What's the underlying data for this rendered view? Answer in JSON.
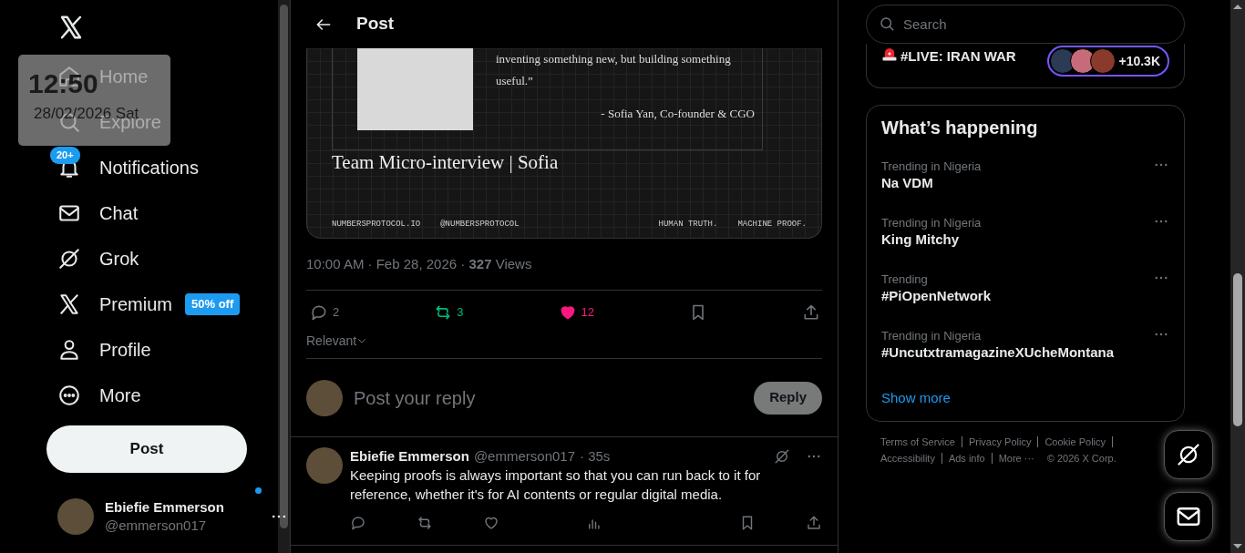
{
  "clock": {
    "time": "12:50",
    "date": "28/02/2026 Sat"
  },
  "sidebar": {
    "items": [
      {
        "label": "Home",
        "selected": false
      },
      {
        "label": "Explore",
        "selected": false
      },
      {
        "label": "Notifications",
        "selected": false,
        "badge": "20+"
      },
      {
        "label": "Chat",
        "selected": false
      },
      {
        "label": "Grok",
        "selected": false
      },
      {
        "label": "Premium",
        "selected": false,
        "tag": "50% off"
      },
      {
        "label": "Profile",
        "selected": false
      },
      {
        "label": "More",
        "selected": false
      }
    ],
    "post_button": "Post",
    "account": {
      "name": "Ebiefie Emmerson",
      "handle": "@emmerson017",
      "unread": true
    }
  },
  "post": {
    "title": "Post",
    "media": {
      "quote": "inventing something new, but building something useful.”",
      "attribution": "- Sofia Yan, Co-founder & CGO",
      "caption": "Team Micro-interview | Sofia",
      "footer_left": [
        "NUMBERSPROTOCOL.IO",
        "@NUMBERSPROTOCOL"
      ],
      "footer_right": [
        "HUMAN TRUTH.",
        "MACHINE PROOF."
      ]
    },
    "meta": "10:00 AM · Feb 28, 2026 · **327** Views",
    "actions": [
      {
        "kind": "reply",
        "count": "2",
        "active": false
      },
      {
        "kind": "repost",
        "count": "3",
        "active": true
      },
      {
        "kind": "like",
        "count": "12",
        "active": true
      },
      {
        "kind": "bookmark",
        "active": false
      },
      {
        "kind": "share"
      }
    ],
    "sort": "Relevant",
    "composer": {
      "placeholder": "Post your reply",
      "button": "Reply",
      "disabled": true
    }
  },
  "replies": [
    {
      "name": "Ebiefie Emmerson",
      "handle": "@emmerson017",
      "time": "· 35s",
      "text": "Keeping proofs is always important so that you can run back to it for reference, whether it's for AI contents or regular digital media.",
      "actions": [
        {
          "kind": "reply"
        },
        {
          "kind": "repost"
        },
        {
          "kind": "like"
        },
        {
          "kind": "views"
        },
        {
          "kind": "bookmark"
        },
        {
          "kind": "share"
        }
      ]
    }
  ],
  "right": {
    "search": {
      "placeholder": "Search"
    },
    "live": {
      "title": "#LIVE: IRAN WAR",
      "count": "+10.3K"
    },
    "trends": {
      "title": "What’s happening",
      "items": [
        {
          "context": "Trending in Nigeria",
          "title": "Na VDM"
        },
        {
          "context": "Trending in Nigeria",
          "title": "King Mitchy"
        },
        {
          "context": "Trending",
          "title": "#PiOpenNetwork"
        },
        {
          "context": "Trending in Nigeria",
          "title": "#UncutxtramagazineXUcheMontana"
        }
      ],
      "show_more": "Show more"
    },
    "footer": {
      "links": [
        {
          "label": "Terms of Service",
          "divider": true
        },
        {
          "label": "Privacy Policy",
          "divider": true
        },
        {
          "label": "Cookie Policy",
          "divider": true
        },
        {
          "label": "Accessibility",
          "divider": true
        },
        {
          "label": "Ads info",
          "divider": true
        },
        {
          "label": "More ···",
          "divider": false
        }
      ],
      "copyright": "© 2026 X Corp."
    }
  }
}
